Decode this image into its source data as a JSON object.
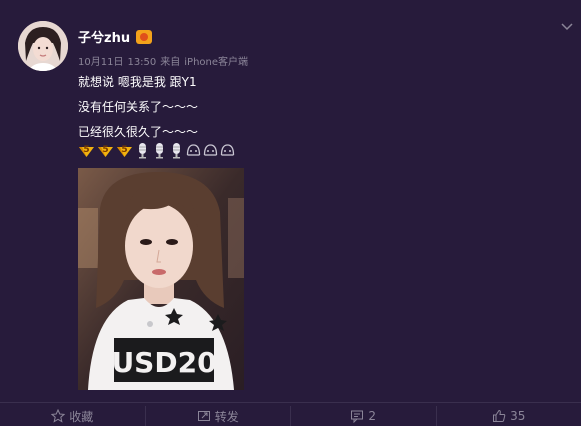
{
  "post": {
    "username": "子兮zhu",
    "meta": {
      "date": "10月11日",
      "time": "13:50",
      "source_prefix": "来自",
      "source": "iPhone客户端"
    },
    "lines": [
      "就想说 嗯我是我 跟Y1",
      "没有任何关系了～～～",
      "已经很久很久了～～～"
    ],
    "emojis": [
      "five-icon",
      "five-icon",
      "five-icon",
      "microphone-icon",
      "microphone-icon",
      "microphone-icon",
      "face-icon",
      "face-icon",
      "face-icon"
    ]
  },
  "actions": {
    "favorite_label": "收藏",
    "repost_label": "转发",
    "comment_count": "2",
    "like_count": "35"
  },
  "colors": {
    "background": "#271b3b",
    "text": "#ffffff",
    "meta_text": "#8b8598",
    "divider": "#3a2f4e"
  }
}
